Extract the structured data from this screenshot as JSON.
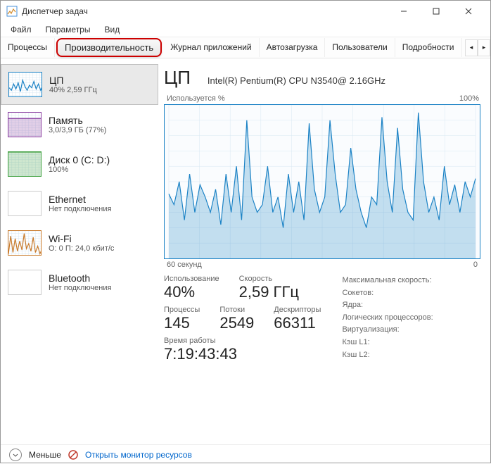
{
  "window": {
    "title": "Диспетчер задач"
  },
  "menu": {
    "file": "Файл",
    "options": "Параметры",
    "view": "Вид"
  },
  "tabs": {
    "processes": "Процессы",
    "performance": "Производительность",
    "apphistory": "Журнал приложений",
    "startup": "Автозагрузка",
    "users": "Пользователи",
    "details": "Подробности"
  },
  "sidebar": {
    "cpu": {
      "title": "ЦП",
      "sub": "40% 2,59 ГГц"
    },
    "memory": {
      "title": "Память",
      "sub": "3,0/3,9 ГБ (77%)"
    },
    "disk": {
      "title": "Диск 0 (C: D:)",
      "sub": "100%"
    },
    "ethernet": {
      "title": "Ethernet",
      "sub": "Нет подключения"
    },
    "wifi": {
      "title": "Wi-Fi",
      "sub": "О: 0 П: 24,0 кбит/с"
    },
    "bluetooth": {
      "title": "Bluetooth",
      "sub": "Нет подключения"
    }
  },
  "main": {
    "title": "ЦП",
    "cpu_name": "Intel(R) Pentium(R) CPU N3540@ 2.16GHz",
    "y_label": "Используется %",
    "y_max": "100%",
    "x_label": "60 секунд",
    "x_right": "0"
  },
  "stats": {
    "usage_lbl": "Использование",
    "usage_val": "40%",
    "speed_lbl": "Скорость",
    "speed_val": "2,59 ГГц",
    "proc_lbl": "Процессы",
    "proc_val": "145",
    "threads_lbl": "Потоки",
    "threads_val": "2549",
    "handles_lbl": "Дескрипторы",
    "handles_val": "66311",
    "uptime_lbl": "Время работы",
    "uptime_val": "7:19:43:43"
  },
  "right": {
    "maxspeed": "Максимальная скорость:",
    "sockets": "Сокетов:",
    "cores": "Ядра:",
    "logical": "Логических процессоров:",
    "virt": "Виртуализация:",
    "l1": "Кэш L1:",
    "l2": "Кэш L2:"
  },
  "footer": {
    "less": "Меньше",
    "resmon": "Открыть монитор ресурсов"
  },
  "chart_data": {
    "type": "line",
    "title": "Используется %",
    "xlabel": "60 секунд",
    "ylabel": "%",
    "ylim": [
      0,
      100
    ],
    "x": [
      0,
      1,
      2,
      3,
      4,
      5,
      6,
      7,
      8,
      9,
      10,
      11,
      12,
      13,
      14,
      15,
      16,
      17,
      18,
      19,
      20,
      21,
      22,
      23,
      24,
      25,
      26,
      27,
      28,
      29,
      30,
      31,
      32,
      33,
      34,
      35,
      36,
      37,
      38,
      39,
      40,
      41,
      42,
      43,
      44,
      45,
      46,
      47,
      48,
      49,
      50,
      51,
      52,
      53,
      54,
      55,
      56,
      57,
      58,
      59
    ],
    "values": [
      42,
      35,
      50,
      25,
      55,
      30,
      48,
      40,
      30,
      45,
      22,
      55,
      30,
      60,
      25,
      90,
      40,
      30,
      35,
      60,
      30,
      40,
      20,
      55,
      30,
      50,
      25,
      88,
      45,
      30,
      40,
      90,
      55,
      30,
      35,
      72,
      45,
      30,
      20,
      40,
      35,
      92,
      50,
      30,
      85,
      45,
      30,
      25,
      95,
      50,
      30,
      40,
      25,
      60,
      35,
      48,
      30,
      50,
      40,
      52
    ]
  },
  "sidebar_charts": {
    "cpu": {
      "type": "line",
      "ylim": [
        0,
        100
      ],
      "values": [
        40,
        30,
        55,
        35,
        60,
        25,
        70,
        45,
        30,
        50,
        40,
        65,
        35,
        55,
        30,
        50
      ]
    },
    "memory": {
      "type": "area",
      "ylim": [
        0,
        100
      ],
      "values": [
        77,
        77,
        77,
        77,
        77,
        77,
        77,
        77,
        77,
        77,
        77,
        77,
        77,
        77,
        77,
        77
      ]
    },
    "disk": {
      "type": "area",
      "ylim": [
        0,
        100
      ],
      "values": [
        100,
        100,
        100,
        100,
        100,
        100,
        100,
        100,
        100,
        100,
        100,
        100,
        100,
        100,
        100,
        100
      ]
    },
    "wifi": {
      "type": "line",
      "ylim": [
        0,
        100
      ],
      "values": [
        10,
        80,
        15,
        70,
        20,
        60,
        25,
        90,
        30,
        50,
        20,
        75,
        15,
        40,
        10,
        30
      ]
    }
  }
}
